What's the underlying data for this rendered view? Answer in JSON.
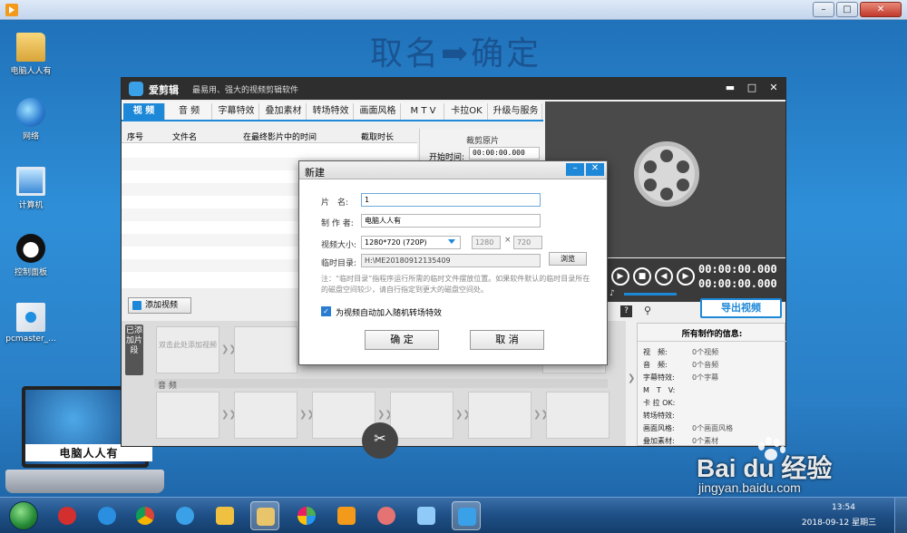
{
  "overlay_caption": "取名➡确定",
  "desktop": {
    "icons": [
      {
        "name": "icon-folder",
        "label": "电脑人人有"
      },
      {
        "name": "icon-network",
        "label": "网络"
      },
      {
        "name": "icon-computer",
        "label": "计算机"
      },
      {
        "name": "icon-panda",
        "label": "控制面板"
      },
      {
        "name": "icon-pcmaster",
        "label": "pcmaster_..."
      }
    ],
    "laptop_label": "电脑人人有"
  },
  "app": {
    "name": "爱剪辑",
    "slogan": "最易用、强大的视频剪辑软件",
    "tabs": [
      "视 频",
      "音 频",
      "字幕特效",
      "叠加素材",
      "转场特效",
      "画面风格",
      "M T V",
      "卡拉OK",
      "升级与服务"
    ],
    "active_tab": "视 频",
    "table_headers": [
      "序号",
      "文件名",
      "在最终影片中的时间",
      "截取时长"
    ],
    "crop_title": "裁剪原片",
    "crop_start_label": "开始时间:",
    "crop_start_value": "00:00:00.000",
    "time_current": "00:00:00.000",
    "time_total": "00:00:00.000",
    "export_label": "导出视频",
    "add_video_label": "添加视频",
    "timeline_side_label": "已添加片段",
    "slot_hint": "双击此处添加视频",
    "audio_label": "音 频",
    "info_title": "所有制作的信息:",
    "info_rows": [
      {
        "k": "视　频:",
        "v": "0个视频"
      },
      {
        "k": "音　频:",
        "v": "0个音频"
      },
      {
        "k": "字幕特效:",
        "v": "0个字幕"
      },
      {
        "k": "M　T　V:",
        "v": ""
      },
      {
        "k": "卡 拉 OK:",
        "v": ""
      },
      {
        "k": "转场特效:",
        "v": ""
      },
      {
        "k": "画面风格:",
        "v": "0个画面风格"
      },
      {
        "k": "叠加素材:",
        "v": "0个素材"
      }
    ]
  },
  "dialog": {
    "title": "新建",
    "name_label": "片　名:",
    "name_value": "1",
    "author_label": "制 作 者:",
    "author_value": "电脑人人有",
    "size_label": "视频大小:",
    "size_value": "1280*720 (720P)",
    "width_value": "1280",
    "height_value": "720",
    "tempdir_label": "临时目录:",
    "tempdir_value": "H:\\ME20180912135409",
    "browse_label": "浏览",
    "hint": "注：“临时目录”指程序运行所需的临时文件摆放位置。如果软件默认的临时目录所在的磁盘空间较少，请自行指定到更大的磁盘空间处。",
    "checkbox_label": "为视频自动加入随机转场特效",
    "checkbox_checked": true,
    "ok_label": "确 定",
    "cancel_label": "取 消"
  },
  "taskbar": {
    "time": "13:54",
    "date": "2018-09-12 星期三"
  },
  "watermark": {
    "logo": "Bai du 经验",
    "url": "jingyan.baidu.com"
  },
  "colors": {
    "accent": "#1e88d8",
    "app_titlebar": "#2e2e2e",
    "preview_bg": "#4a4a4a"
  }
}
